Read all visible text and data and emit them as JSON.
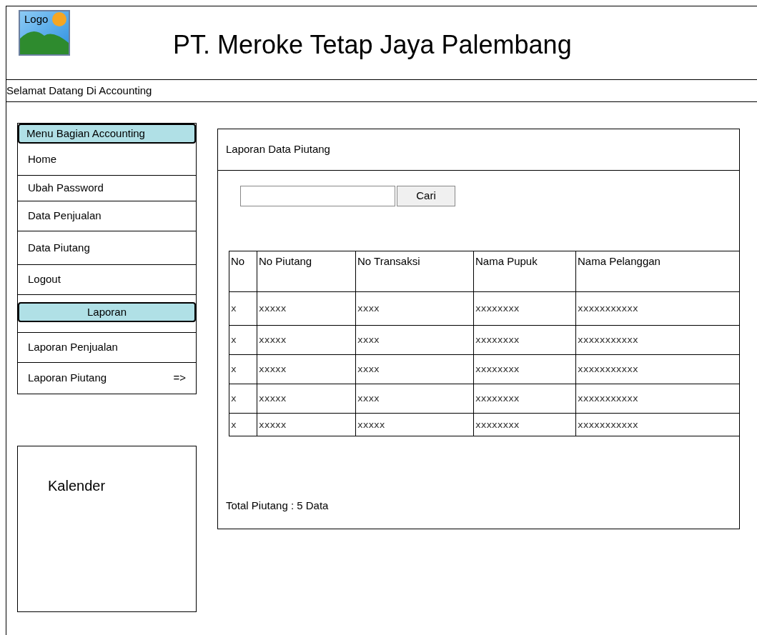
{
  "header": {
    "logo_label": "Logo",
    "title": "PT. Meroke Tetap Jaya Palembang"
  },
  "welcome": "Selamat Datang Di Accounting",
  "sidebar": {
    "items": [
      {
        "kind": "heading",
        "label": "Menu Bagian Accounting"
      },
      {
        "kind": "item",
        "label": "Home"
      },
      {
        "kind": "item",
        "label": "Ubah Password"
      },
      {
        "kind": "item",
        "label": "Data Penjualan"
      },
      {
        "kind": "item",
        "label": "Data Piutang"
      },
      {
        "kind": "item",
        "label": "Logout"
      },
      {
        "kind": "heading",
        "label": "Laporan"
      },
      {
        "kind": "item",
        "label": "Laporan Penjualan"
      },
      {
        "kind": "item",
        "label": "Laporan Piutang",
        "marker": "=>"
      }
    ]
  },
  "calendar": {
    "label": "Kalender"
  },
  "main": {
    "title": "Laporan Data Piutang",
    "search_button": "Cari",
    "table": {
      "columns": [
        "No",
        "No Piutang",
        "No Transaksi",
        "Nama Pupuk",
        "Nama Pelanggan"
      ],
      "rows": [
        [
          "x",
          "xxxxx",
          "xxxx",
          "xxxxxxxx",
          "xxxxxxxxxxx"
        ],
        [
          "x",
          "xxxxx",
          "xxxx",
          "xxxxxxxx",
          "xxxxxxxxxxx"
        ],
        [
          "x",
          "xxxxx",
          "xxxx",
          "xxxxxxxx",
          "xxxxxxxxxxx"
        ],
        [
          "x",
          "xxxxx",
          "xxxx",
          "xxxxxxxx",
          "xxxxxxxxxxx"
        ],
        [
          "x",
          "xxxxx",
          "xxxxx",
          "xxxxxxxx",
          "xxxxxxxxxxx"
        ]
      ]
    },
    "total": "Total Piutang : 5 Data"
  }
}
